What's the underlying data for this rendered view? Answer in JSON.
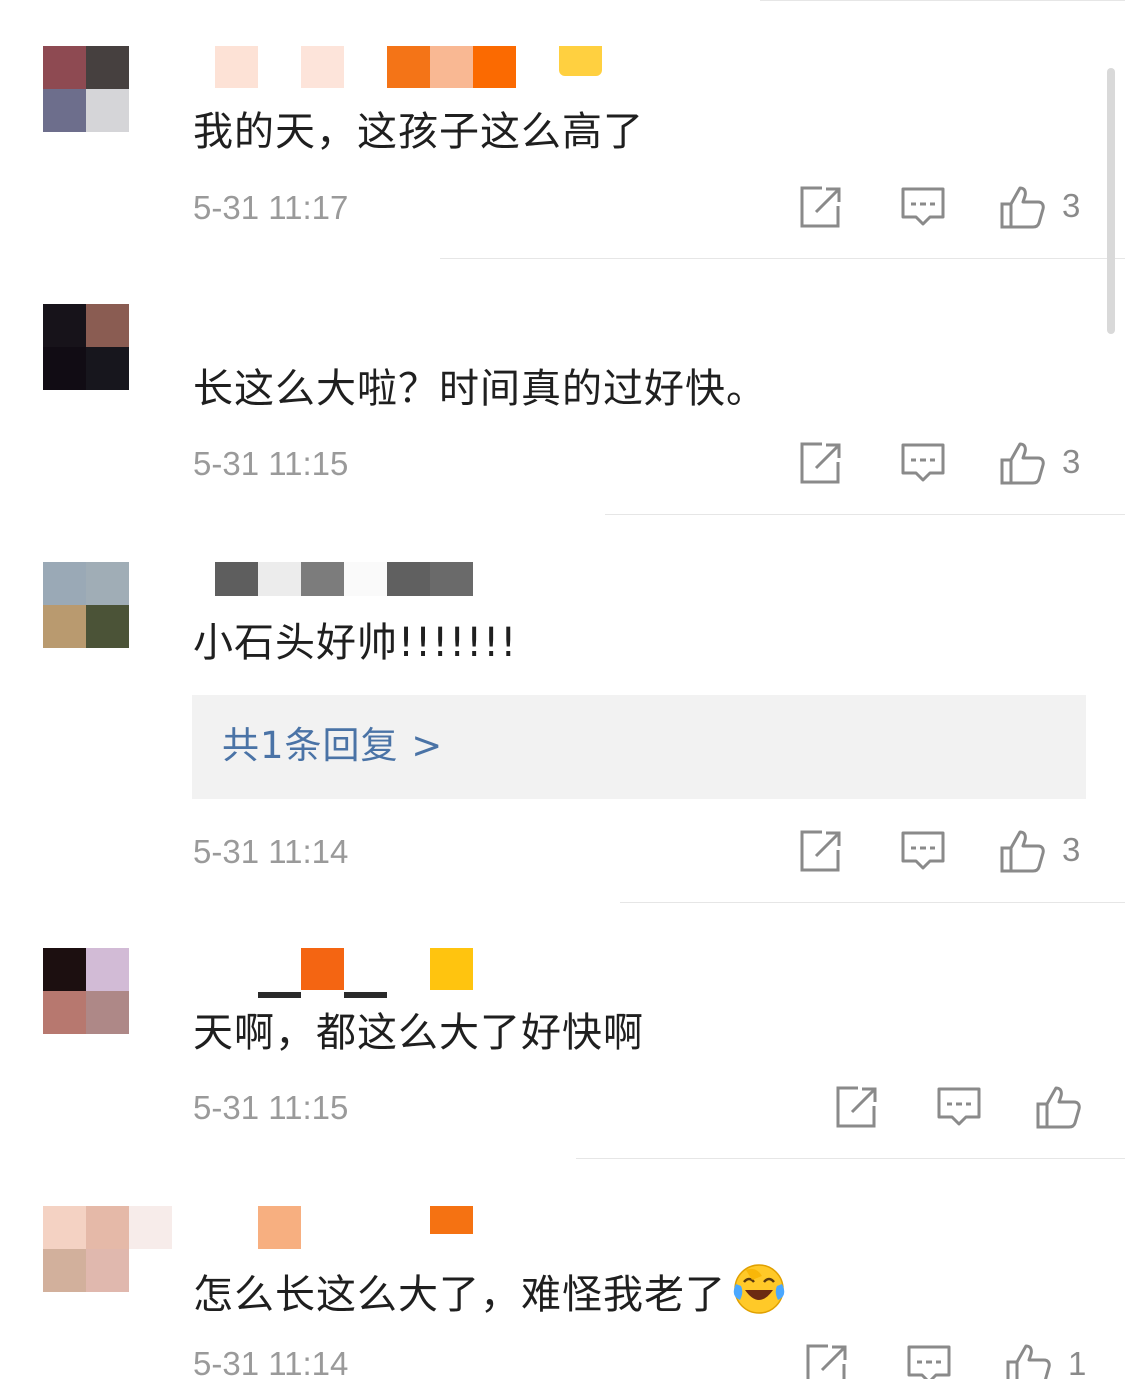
{
  "comments": [
    {
      "text": "我的天，这孩子这么高了",
      "time": "5-31 11:17",
      "likes": "3",
      "avatar_colors": [
        "#8e4a52",
        "#46403f",
        "#6d6e8c",
        "#d5d5d8"
      ],
      "name_blocks": [
        "#fde2d6",
        "#fde4da",
        "#f47417",
        "#f9b893",
        "#fb6a01",
        "#ffd040"
      ]
    },
    {
      "text": "长这么大啦？时间真的过好快。",
      "time": "5-31 11:15",
      "likes": "3",
      "avatar_colors": [
        "#17131a",
        "#8a5c52",
        "#110c14",
        "#17161d"
      ],
      "name_blocks": []
    },
    {
      "text": "小石头好帅!!!!!!!",
      "time": "5-31 11:14",
      "likes": "3",
      "replies_label": "共1条回复 >",
      "avatar_colors": [
        "#9aa9b6",
        "#a0adb6",
        "#b99a6f",
        "#4b5337"
      ],
      "name_blocks": [
        "#5e5e5e",
        "#ececec",
        "#7c7c7c",
        "#fafafa",
        "#606060",
        "#6a6a6a"
      ]
    },
    {
      "text": "天啊，都这么大了好快啊",
      "time": "5-31 11:15",
      "likes": "",
      "avatar_colors": [
        "#1c0f10",
        "#d2bbd6",
        "#b7786f",
        "#ae8887"
      ],
      "name_blocks": [
        "#2a2a2a",
        "#f46512",
        "#2a2a2a",
        "#ffc40f"
      ]
    },
    {
      "text": "怎么长这么大了，难怪我老了",
      "time": "5-31 11:14",
      "likes": "1",
      "emoji": "laughing-crying-emoji",
      "avatar_colors": [
        "#f4d2c3",
        "#e5b9a8",
        "#d2b09c",
        "#e0b8ae"
      ],
      "name_blocks": [
        "#f7af80",
        "#f57212"
      ]
    }
  ],
  "icons": {
    "share": "share-icon",
    "comment": "comment-icon",
    "like": "thumbs-up-icon"
  },
  "colors": {
    "text": "#1f1f1f",
    "meta": "#9a9a9a",
    "reply_link": "#4a73a6",
    "reply_bg": "#f2f2f2"
  }
}
